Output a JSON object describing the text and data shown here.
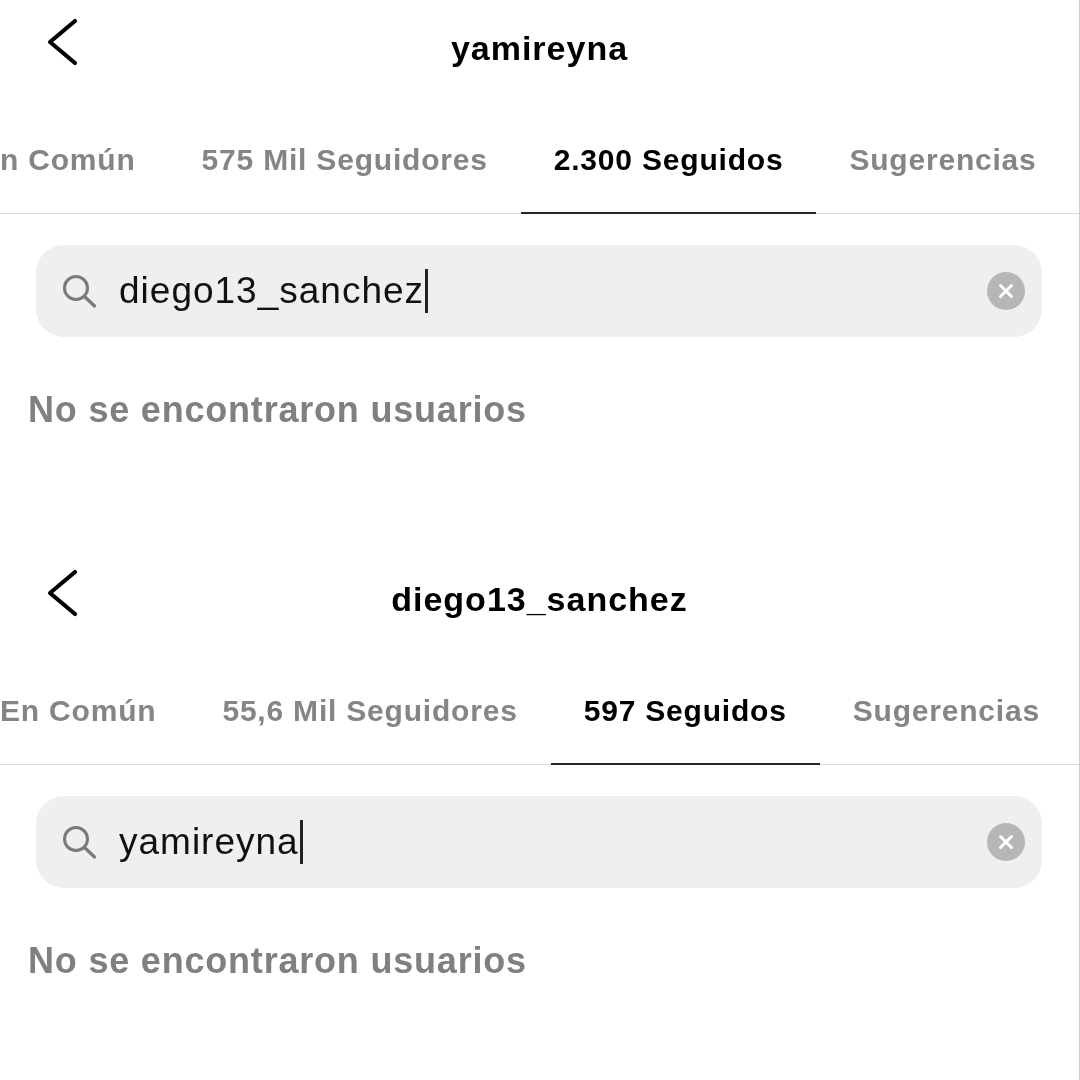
{
  "panels": [
    {
      "header": {
        "title": "yamireyna"
      },
      "tabs": [
        {
          "label": "n Común",
          "selected": false
        },
        {
          "label": "575 Mil Seguidores",
          "selected": false
        },
        {
          "label": "2.300 Seguidos",
          "selected": true
        },
        {
          "label": "Sugerencias",
          "selected": false
        }
      ],
      "search": {
        "value": "diego13_sanchez",
        "focused": true
      },
      "empty_message": "No se encontraron usuarios"
    },
    {
      "header": {
        "title": "diego13_sanchez"
      },
      "tabs": [
        {
          "label": "En Común",
          "selected": false
        },
        {
          "label": "55,6 Mil Seguidores",
          "selected": false
        },
        {
          "label": "597 Seguidos",
          "selected": true
        },
        {
          "label": "Sugerencias",
          "selected": false
        }
      ],
      "search": {
        "value": "yamireyna",
        "focused": true
      },
      "empty_message": "No se encontraron usuarios"
    }
  ]
}
